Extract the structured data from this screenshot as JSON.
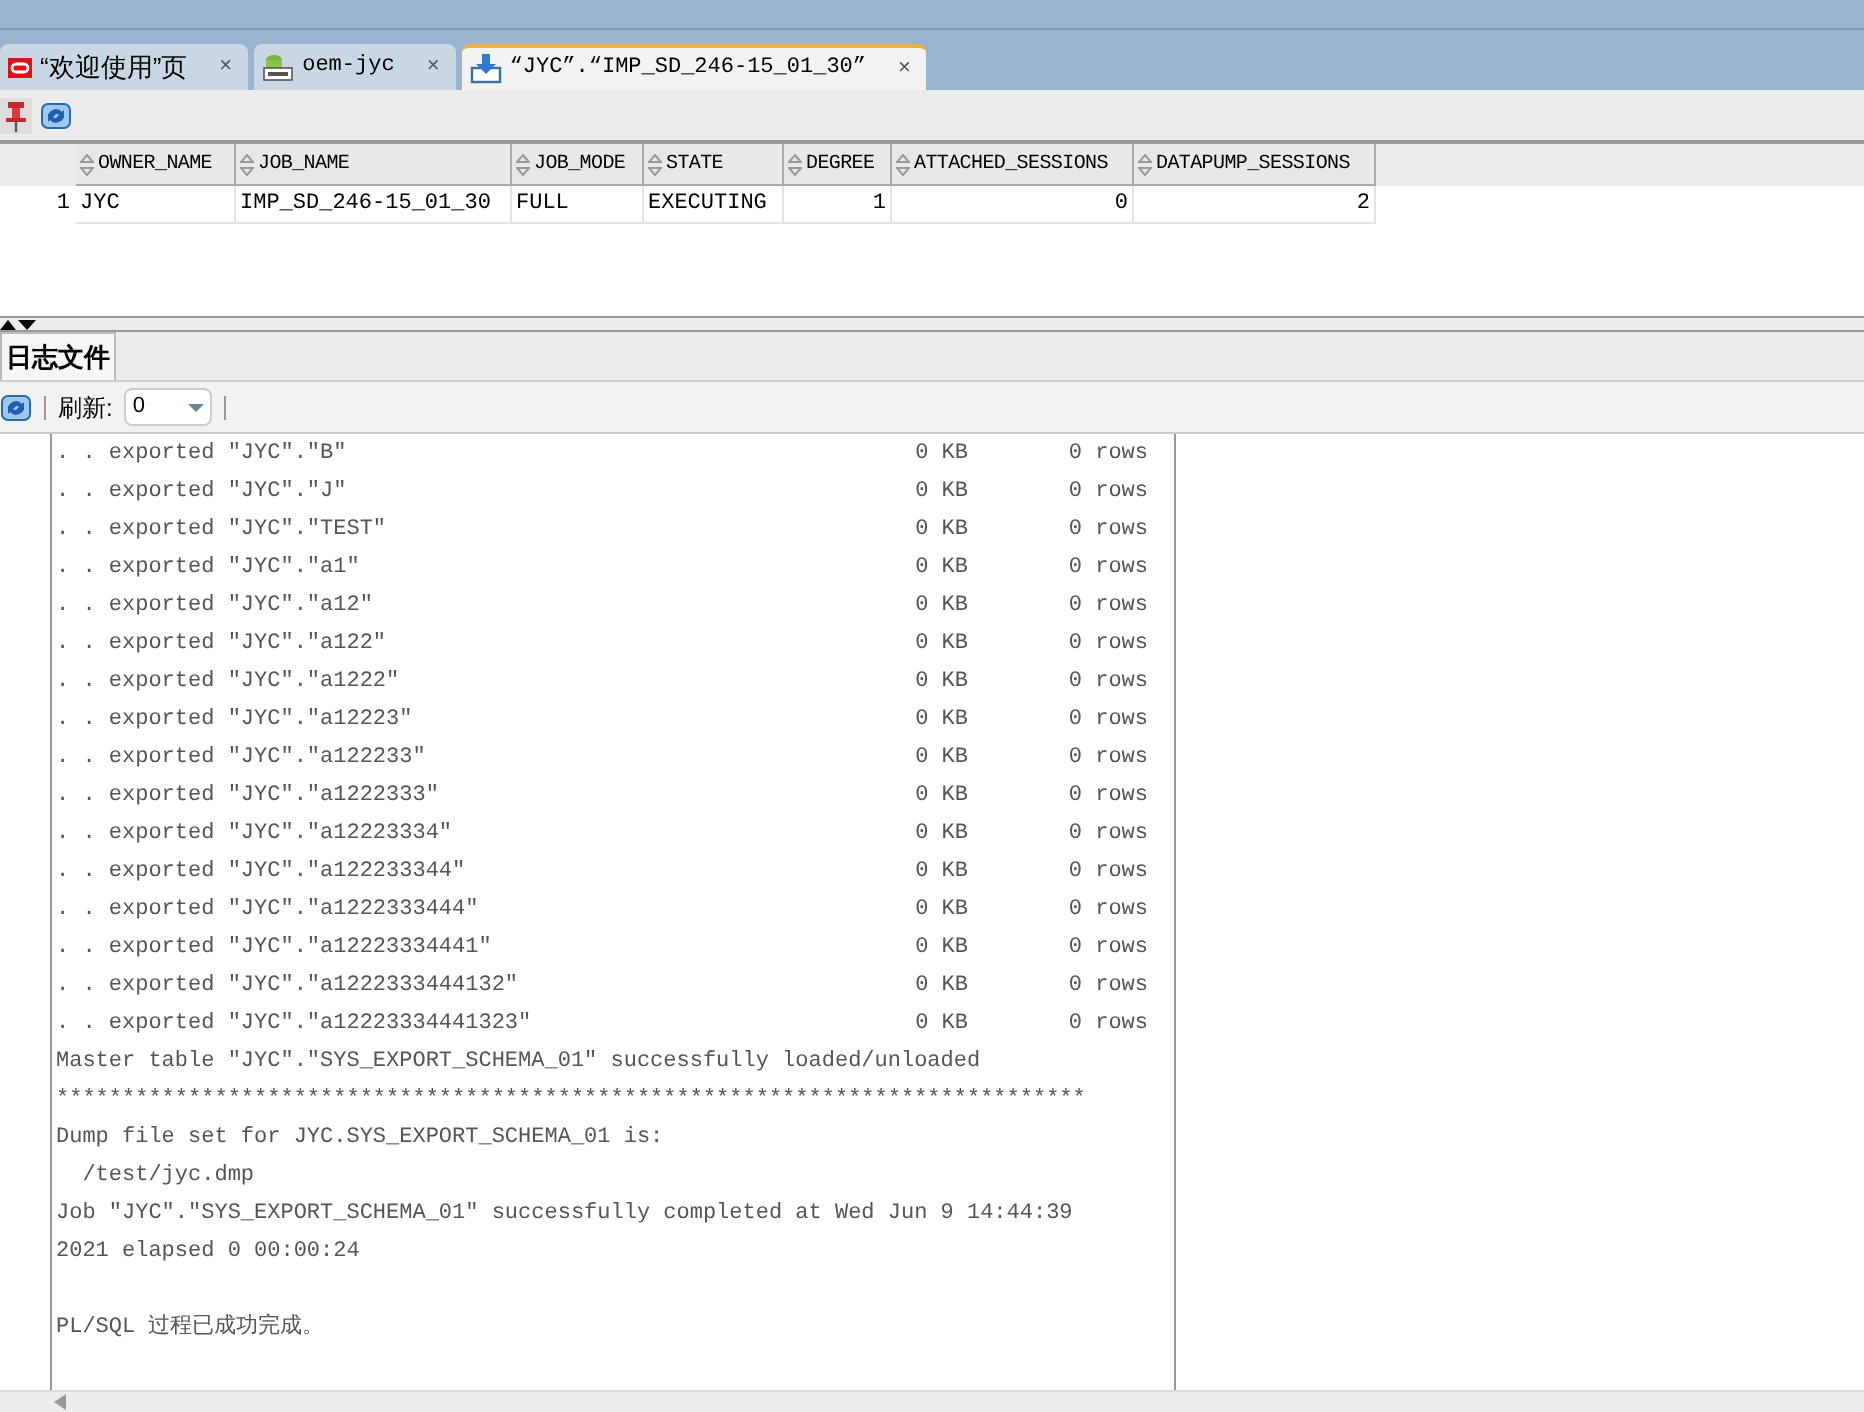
{
  "tabs": [
    {
      "label": "“欢迎使用”页",
      "kind": "oracle",
      "close": "×",
      "selected": false
    },
    {
      "label": "oem-jyc",
      "kind": "sql",
      "close": "×",
      "selected": false
    },
    {
      "label": "“JYC”.“IMP_SD_246-15_01_30”",
      "kind": "download",
      "close": "×",
      "selected": true
    }
  ],
  "table": {
    "columns": [
      "OWNER_NAME",
      "JOB_NAME",
      "JOB_MODE",
      "STATE",
      "DEGREE",
      "ATTACHED_SESSIONS",
      "DATAPUMP_SESSIONS"
    ],
    "rows": [
      {
        "number": "1",
        "cells": [
          "JYC",
          "IMP_SD_246-15_01_30",
          "FULL",
          "EXECUTING",
          "1",
          "0",
          "2"
        ]
      }
    ]
  },
  "log_panel": {
    "tab": {
      "label": "日志文件",
      "selected": true
    },
    "refresh_label": "刷新:",
    "refresh_value": "0",
    "lines": [
      {
        "kind": "export",
        "text": ". . exported \"JYC\".\"B\"",
        "size": "0 KB",
        "rows": "0 rows"
      },
      {
        "kind": "export",
        "text": ". . exported \"JYC\".\"J\"",
        "size": "0 KB",
        "rows": "0 rows"
      },
      {
        "kind": "export",
        "text": ". . exported \"JYC\".\"TEST\"",
        "size": "0 KB",
        "rows": "0 rows"
      },
      {
        "kind": "export",
        "text": ". . exported \"JYC\".\"a1\"",
        "size": "0 KB",
        "rows": "0 rows"
      },
      {
        "kind": "export",
        "text": ". . exported \"JYC\".\"a12\"",
        "size": "0 KB",
        "rows": "0 rows"
      },
      {
        "kind": "export",
        "text": ". . exported \"JYC\".\"a122\"",
        "size": "0 KB",
        "rows": "0 rows"
      },
      {
        "kind": "export",
        "text": ". . exported \"JYC\".\"a1222\"",
        "size": "0 KB",
        "rows": "0 rows"
      },
      {
        "kind": "export",
        "text": ". . exported \"JYC\".\"a12223\"",
        "size": "0 KB",
        "rows": "0 rows"
      },
      {
        "kind": "export",
        "text": ". . exported \"JYC\".\"a122233\"",
        "size": "0 KB",
        "rows": "0 rows"
      },
      {
        "kind": "export",
        "text": ". . exported \"JYC\".\"a1222333\"",
        "size": "0 KB",
        "rows": "0 rows"
      },
      {
        "kind": "export",
        "text": ". . exported \"JYC\".\"a12223334\"",
        "size": "0 KB",
        "rows": "0 rows"
      },
      {
        "kind": "export",
        "text": ". . exported \"JYC\".\"a122233344\"",
        "size": "0 KB",
        "rows": "0 rows"
      },
      {
        "kind": "export",
        "text": ". . exported \"JYC\".\"a1222333444\"",
        "size": "0 KB",
        "rows": "0 rows"
      },
      {
        "kind": "export",
        "text": ". . exported \"JYC\".\"a12223334441\"",
        "size": "0 KB",
        "rows": "0 rows"
      },
      {
        "kind": "export",
        "text": ". . exported \"JYC\".\"a1222333444132\"",
        "size": "0 KB",
        "rows": "0 rows"
      },
      {
        "kind": "export",
        "text": ". . exported \"JYC\".\"a12223334441323\"",
        "size": "0 KB",
        "rows": "0 rows"
      },
      {
        "kind": "text",
        "text": "Master table \"JYC\".\"SYS_EXPORT_SCHEMA_01\" successfully loaded/unloaded"
      },
      {
        "kind": "text",
        "text": "******************************************************************************"
      },
      {
        "kind": "text",
        "text": "Dump file set for JYC.SYS_EXPORT_SCHEMA_01 is:"
      },
      {
        "kind": "text",
        "text": "  /test/jyc.dmp"
      },
      {
        "kind": "text",
        "text": "Job \"JYC\".\"SYS_EXPORT_SCHEMA_01\" successfully completed at Wed Jun 9 14:44:39"
      },
      {
        "kind": "text",
        "text": "2021 elapsed 0 00:00:24"
      },
      {
        "kind": "blank"
      },
      {
        "kind": "text",
        "text": "PL/SQL 过程已成功完成。"
      }
    ]
  }
}
